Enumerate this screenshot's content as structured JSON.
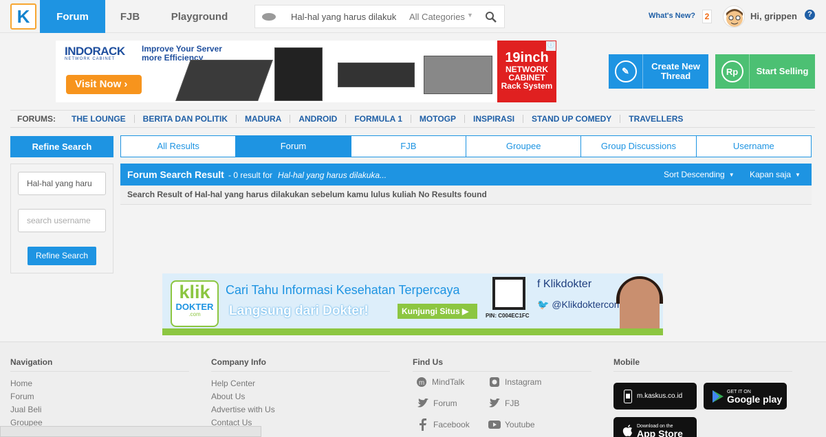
{
  "topbar": {
    "logo_letter": "K",
    "nav": {
      "forum": "Forum",
      "fjb": "FJB",
      "playground": "Playground"
    },
    "search": {
      "query": "Hal-hal yang harus dilakuk",
      "category": "All Categories"
    },
    "whats_new": "What's New?",
    "notification_count": "2",
    "greeting": "Hi, grippen",
    "help": "?"
  },
  "ad_top": {
    "brand": "INDORACK",
    "brand_sub": "NETWORK CABINET",
    "tagline": "Improve Your Server more Efficiency",
    "cta": "Visit Now",
    "badge_line1": "19inch",
    "badge_line2": "NETWORK",
    "badge_line3": "CABINET",
    "badge_line4": "Rack System"
  },
  "cta": {
    "create_thread": "Create New Thread",
    "start_selling": "Start Selling",
    "selling_icon": "Rp"
  },
  "forums": {
    "label": "FORUMS:",
    "items": [
      "THE LOUNGE",
      "BERITA DAN POLITIK",
      "MADURA",
      "ANDROID",
      "FORMULA 1",
      "MOTOGP",
      "INSPIRASI",
      "STAND UP COMEDY",
      "TRAVELLERS"
    ]
  },
  "refine": {
    "title": "Refine Search",
    "query_value": "Hal-hal yang haru",
    "username_placeholder": "search username",
    "button": "Refine Search"
  },
  "tabs": [
    "All Results",
    "Forum",
    "FJB",
    "Groupee",
    "Group Discussions",
    "Username"
  ],
  "result": {
    "title": "Forum Search Result",
    "count": "- 0 result for",
    "query": "Hal-hal yang harus dilakuka...",
    "sort_order": "Sort Descending",
    "time": "Kapan saja",
    "message": "Search Result of Hal-hal yang harus dilakukan sebelum kamu lulus kuliah No Results found"
  },
  "ad_bottom": {
    "logo_top": "klik",
    "logo_mid": "DOKTER",
    "logo_bot": ".com",
    "headline": "Cari Tahu Informasi Kesehatan Terpercaya",
    "subline": "Langsung dari Dokter!",
    "button": "Kunjungi Situs",
    "pin": "PIN: C004EC1FC",
    "facebook": "Klikdokter",
    "twitter": "@Klikdoktercom"
  },
  "footer": {
    "navigation": {
      "title": "Navigation",
      "links": [
        "Home",
        "Forum",
        "Jual Beli",
        "Groupee"
      ]
    },
    "company": {
      "title": "Company Info",
      "links": [
        "Help Center",
        "About Us",
        "Advertise with Us",
        "Contact Us"
      ]
    },
    "find_us": {
      "title": "Find Us",
      "links": {
        "mindtalk": "MindTalk",
        "instagram": "Instagram",
        "forum": "Forum",
        "fjb": "FJB",
        "facebook": "Facebook",
        "youtube": "Youtube"
      }
    },
    "mobile": {
      "title": "Mobile",
      "mobile_site": "m.kaskus.co.id",
      "google_top": "GET IT ON",
      "google_bottom": "Google play",
      "apple_top": "Download on the",
      "apple_bottom": "App Store"
    }
  }
}
